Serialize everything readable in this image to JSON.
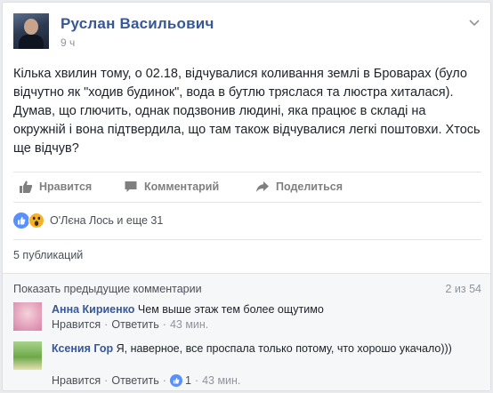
{
  "post": {
    "author": "Руслан Васильович",
    "time": "9 ч",
    "text": "Кілька хвилин тому, о 02.18, відчувалися коливання землі в Броварах (було відчутно як \"ходив будинок\", вода в бутлю тряслася та люстра хиталася). Думав, що глючить, однак подзвонив людині, яка працює в складі на окружній і вона підтвердила, що там також відчувалися легкі поштовхи. Хтось ще відчув?"
  },
  "actions": {
    "like": "Нравится",
    "comment": "Комментарий",
    "share": "Поделиться"
  },
  "reactions": {
    "names": "О'Лєна Лось и еще 31",
    "icons": [
      "like-icon",
      "wow-icon"
    ]
  },
  "shares": "5 публикаций",
  "comments": {
    "show_previous": "Показать предыдущие комментарии",
    "count": "2 из 54",
    "items": [
      {
        "name": "Анна Кириенко",
        "text": "Чем выше этаж тем более ощутимо",
        "like": "Нравится",
        "reply": "Ответить",
        "time": "43 мин.",
        "reactions": ""
      },
      {
        "name": "Ксения Гор",
        "text": "Я, наверное, все проспала только потому, что хорошо укачало)))",
        "like": "Нравится",
        "reply": "Ответить",
        "time": "43 мин.",
        "reactions": "1"
      }
    ]
  },
  "colors": {
    "link": "#365899",
    "like_blue": "#5890ff",
    "wow_yellow": "#f7b125",
    "muted": "#90949c"
  }
}
